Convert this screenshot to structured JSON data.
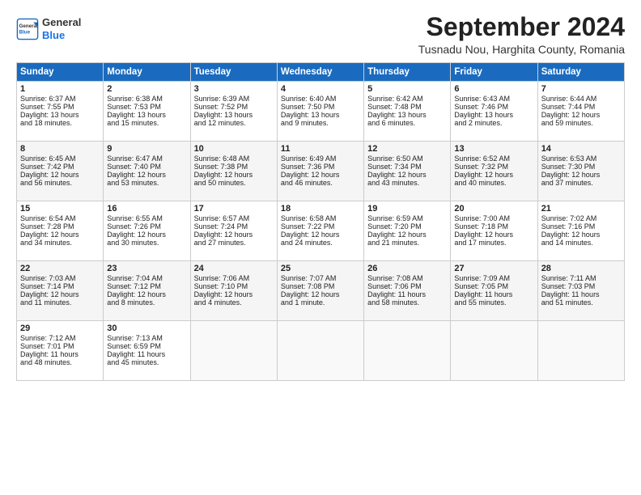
{
  "header": {
    "logo_line1": "General",
    "logo_line2": "Blue",
    "month_title": "September 2024",
    "subtitle": "Tusnadu Nou, Harghita County, Romania"
  },
  "weekdays": [
    "Sunday",
    "Monday",
    "Tuesday",
    "Wednesday",
    "Thursday",
    "Friday",
    "Saturday"
  ],
  "weeks": [
    [
      {
        "day": "1",
        "lines": [
          "Sunrise: 6:37 AM",
          "Sunset: 7:55 PM",
          "Daylight: 13 hours",
          "and 18 minutes."
        ]
      },
      {
        "day": "2",
        "lines": [
          "Sunrise: 6:38 AM",
          "Sunset: 7:53 PM",
          "Daylight: 13 hours",
          "and 15 minutes."
        ]
      },
      {
        "day": "3",
        "lines": [
          "Sunrise: 6:39 AM",
          "Sunset: 7:52 PM",
          "Daylight: 13 hours",
          "and 12 minutes."
        ]
      },
      {
        "day": "4",
        "lines": [
          "Sunrise: 6:40 AM",
          "Sunset: 7:50 PM",
          "Daylight: 13 hours",
          "and 9 minutes."
        ]
      },
      {
        "day": "5",
        "lines": [
          "Sunrise: 6:42 AM",
          "Sunset: 7:48 PM",
          "Daylight: 13 hours",
          "and 6 minutes."
        ]
      },
      {
        "day": "6",
        "lines": [
          "Sunrise: 6:43 AM",
          "Sunset: 7:46 PM",
          "Daylight: 13 hours",
          "and 2 minutes."
        ]
      },
      {
        "day": "7",
        "lines": [
          "Sunrise: 6:44 AM",
          "Sunset: 7:44 PM",
          "Daylight: 12 hours",
          "and 59 minutes."
        ]
      }
    ],
    [
      {
        "day": "8",
        "lines": [
          "Sunrise: 6:45 AM",
          "Sunset: 7:42 PM",
          "Daylight: 12 hours",
          "and 56 minutes."
        ]
      },
      {
        "day": "9",
        "lines": [
          "Sunrise: 6:47 AM",
          "Sunset: 7:40 PM",
          "Daylight: 12 hours",
          "and 53 minutes."
        ]
      },
      {
        "day": "10",
        "lines": [
          "Sunrise: 6:48 AM",
          "Sunset: 7:38 PM",
          "Daylight: 12 hours",
          "and 50 minutes."
        ]
      },
      {
        "day": "11",
        "lines": [
          "Sunrise: 6:49 AM",
          "Sunset: 7:36 PM",
          "Daylight: 12 hours",
          "and 46 minutes."
        ]
      },
      {
        "day": "12",
        "lines": [
          "Sunrise: 6:50 AM",
          "Sunset: 7:34 PM",
          "Daylight: 12 hours",
          "and 43 minutes."
        ]
      },
      {
        "day": "13",
        "lines": [
          "Sunrise: 6:52 AM",
          "Sunset: 7:32 PM",
          "Daylight: 12 hours",
          "and 40 minutes."
        ]
      },
      {
        "day": "14",
        "lines": [
          "Sunrise: 6:53 AM",
          "Sunset: 7:30 PM",
          "Daylight: 12 hours",
          "and 37 minutes."
        ]
      }
    ],
    [
      {
        "day": "15",
        "lines": [
          "Sunrise: 6:54 AM",
          "Sunset: 7:28 PM",
          "Daylight: 12 hours",
          "and 34 minutes."
        ]
      },
      {
        "day": "16",
        "lines": [
          "Sunrise: 6:55 AM",
          "Sunset: 7:26 PM",
          "Daylight: 12 hours",
          "and 30 minutes."
        ]
      },
      {
        "day": "17",
        "lines": [
          "Sunrise: 6:57 AM",
          "Sunset: 7:24 PM",
          "Daylight: 12 hours",
          "and 27 minutes."
        ]
      },
      {
        "day": "18",
        "lines": [
          "Sunrise: 6:58 AM",
          "Sunset: 7:22 PM",
          "Daylight: 12 hours",
          "and 24 minutes."
        ]
      },
      {
        "day": "19",
        "lines": [
          "Sunrise: 6:59 AM",
          "Sunset: 7:20 PM",
          "Daylight: 12 hours",
          "and 21 minutes."
        ]
      },
      {
        "day": "20",
        "lines": [
          "Sunrise: 7:00 AM",
          "Sunset: 7:18 PM",
          "Daylight: 12 hours",
          "and 17 minutes."
        ]
      },
      {
        "day": "21",
        "lines": [
          "Sunrise: 7:02 AM",
          "Sunset: 7:16 PM",
          "Daylight: 12 hours",
          "and 14 minutes."
        ]
      }
    ],
    [
      {
        "day": "22",
        "lines": [
          "Sunrise: 7:03 AM",
          "Sunset: 7:14 PM",
          "Daylight: 12 hours",
          "and 11 minutes."
        ]
      },
      {
        "day": "23",
        "lines": [
          "Sunrise: 7:04 AM",
          "Sunset: 7:12 PM",
          "Daylight: 12 hours",
          "and 8 minutes."
        ]
      },
      {
        "day": "24",
        "lines": [
          "Sunrise: 7:06 AM",
          "Sunset: 7:10 PM",
          "Daylight: 12 hours",
          "and 4 minutes."
        ]
      },
      {
        "day": "25",
        "lines": [
          "Sunrise: 7:07 AM",
          "Sunset: 7:08 PM",
          "Daylight: 12 hours",
          "and 1 minute."
        ]
      },
      {
        "day": "26",
        "lines": [
          "Sunrise: 7:08 AM",
          "Sunset: 7:06 PM",
          "Daylight: 11 hours",
          "and 58 minutes."
        ]
      },
      {
        "day": "27",
        "lines": [
          "Sunrise: 7:09 AM",
          "Sunset: 7:05 PM",
          "Daylight: 11 hours",
          "and 55 minutes."
        ]
      },
      {
        "day": "28",
        "lines": [
          "Sunrise: 7:11 AM",
          "Sunset: 7:03 PM",
          "Daylight: 11 hours",
          "and 51 minutes."
        ]
      }
    ],
    [
      {
        "day": "29",
        "lines": [
          "Sunrise: 7:12 AM",
          "Sunset: 7:01 PM",
          "Daylight: 11 hours",
          "and 48 minutes."
        ]
      },
      {
        "day": "30",
        "lines": [
          "Sunrise: 7:13 AM",
          "Sunset: 6:59 PM",
          "Daylight: 11 hours",
          "and 45 minutes."
        ]
      },
      {
        "day": "",
        "lines": []
      },
      {
        "day": "",
        "lines": []
      },
      {
        "day": "",
        "lines": []
      },
      {
        "day": "",
        "lines": []
      },
      {
        "day": "",
        "lines": []
      }
    ]
  ]
}
